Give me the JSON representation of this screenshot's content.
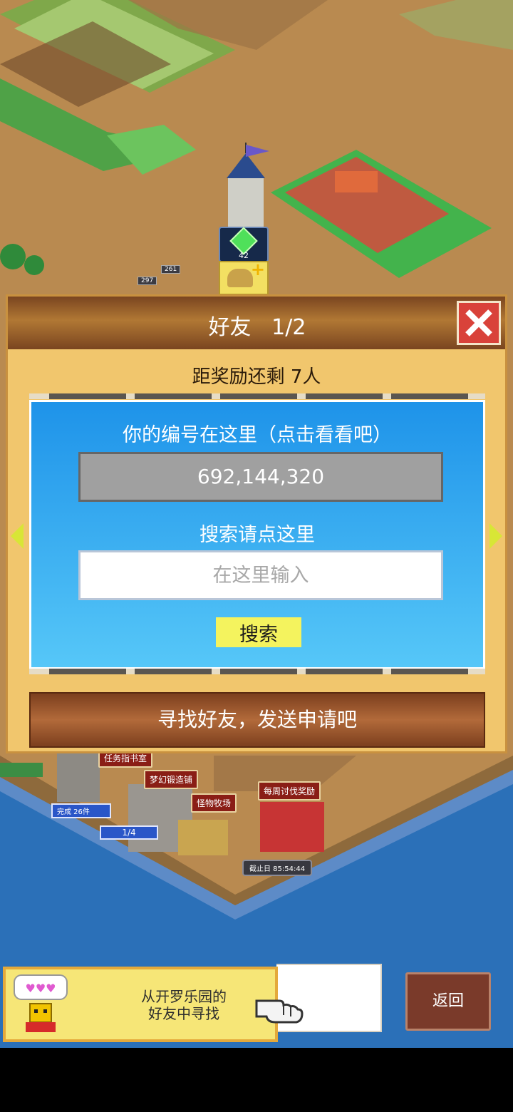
{
  "world": {
    "building_labels": [
      "任务指书室",
      "梦幻锻造铺",
      "怪物牧场",
      "每周讨伐奖励"
    ],
    "complete_badge": "完成 26件",
    "progress_badge": "1/4",
    "deadline_badge": "截止日 85:54:44",
    "tag_left": "297",
    "tag_mid": "261",
    "gem_count": "42"
  },
  "dialog": {
    "title": "好友   1/2",
    "remaining_text": "距奖励还剩 7人",
    "id_label": "你的编号在这里（点击看看吧）",
    "id_value": "692,144,320",
    "search_label": "搜索请点这里",
    "search_placeholder": "在这里输入",
    "search_button": "搜索",
    "find_button": "寻找好友，发送申请吧"
  },
  "bottom": {
    "kairo_line1": "从开罗乐园的",
    "kairo_line2": "好友中寻找",
    "back_button": "返回"
  },
  "icons": {
    "close": "close-icon",
    "arrow_left": "arrow-left-icon",
    "arrow_right": "arrow-right-icon",
    "hand": "pointing-hand-icon",
    "mascot": "kairo-mascot-icon",
    "gem": "gem-icon",
    "friend_add": "friend-add-icon"
  },
  "colors": {
    "dialog_bg": "#f1c66d",
    "header_brown": "#7a4520",
    "panel_blue": "#1e93e9",
    "close_red": "#d9423a",
    "search_yellow": "#f4f35e",
    "sea_blue": "#2b70b8"
  }
}
